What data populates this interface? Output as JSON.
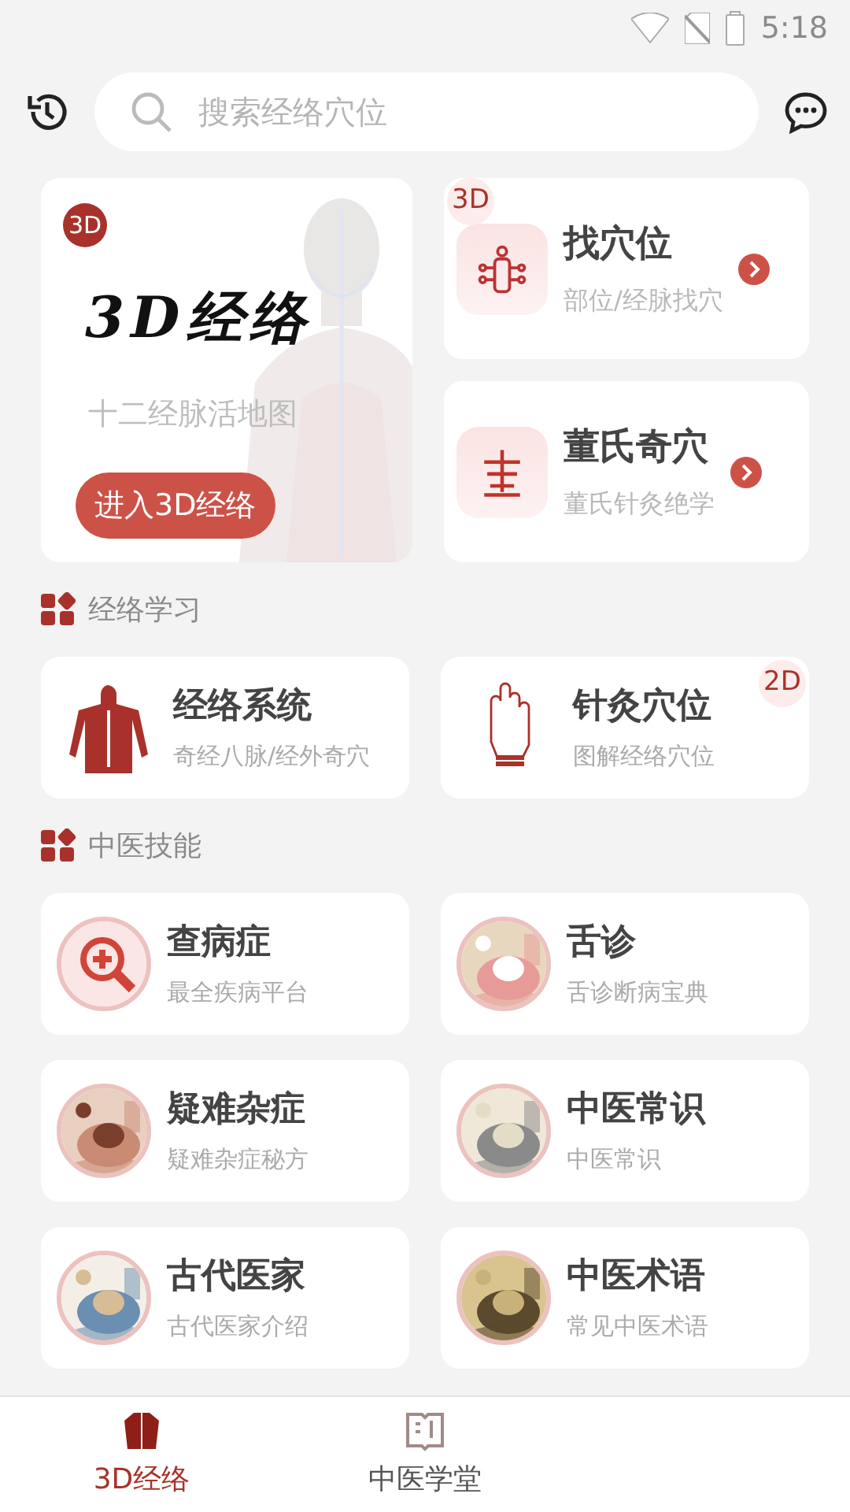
{
  "status_bar": {
    "time": "5:18"
  },
  "search": {
    "placeholder": "搜索经络穴位"
  },
  "feature": {
    "badge": "3D",
    "logo": "3D经络",
    "subtitle": "十二经脉活地图",
    "button": "进入3D经络"
  },
  "quick": [
    {
      "badge": "3D",
      "title": "找穴位",
      "subtitle": "部位/经脉找穴"
    },
    {
      "title": "董氏奇穴",
      "subtitle": "董氏针灸绝学"
    }
  ],
  "sections": [
    {
      "title": "经络学习",
      "items": [
        {
          "kind": "icon",
          "title": "经络系统",
          "subtitle": "奇经八脉/经外奇穴"
        },
        {
          "kind": "icon",
          "title": "针灸穴位",
          "subtitle": "图解经络穴位",
          "badge": "2D"
        }
      ]
    },
    {
      "title": "中医技能",
      "items": [
        {
          "kind": "icon",
          "title": "查病症",
          "subtitle": "最全疾病平台"
        },
        {
          "kind": "picture",
          "title": "舌诊",
          "subtitle": "舌诊断病宝典"
        },
        {
          "kind": "picture",
          "title": "疑难杂症",
          "subtitle": "疑难杂症秘方"
        },
        {
          "kind": "picture",
          "title": "中医常识",
          "subtitle": "中医常识"
        },
        {
          "kind": "picture",
          "title": "古代医家",
          "subtitle": "古代医家介绍"
        },
        {
          "kind": "picture",
          "title": "中医术语",
          "subtitle": "常见中医术语"
        }
      ]
    }
  ],
  "bottom_nav": [
    {
      "label": "3D经络",
      "selected": true
    },
    {
      "label": "中医学堂",
      "selected": false
    }
  ]
}
